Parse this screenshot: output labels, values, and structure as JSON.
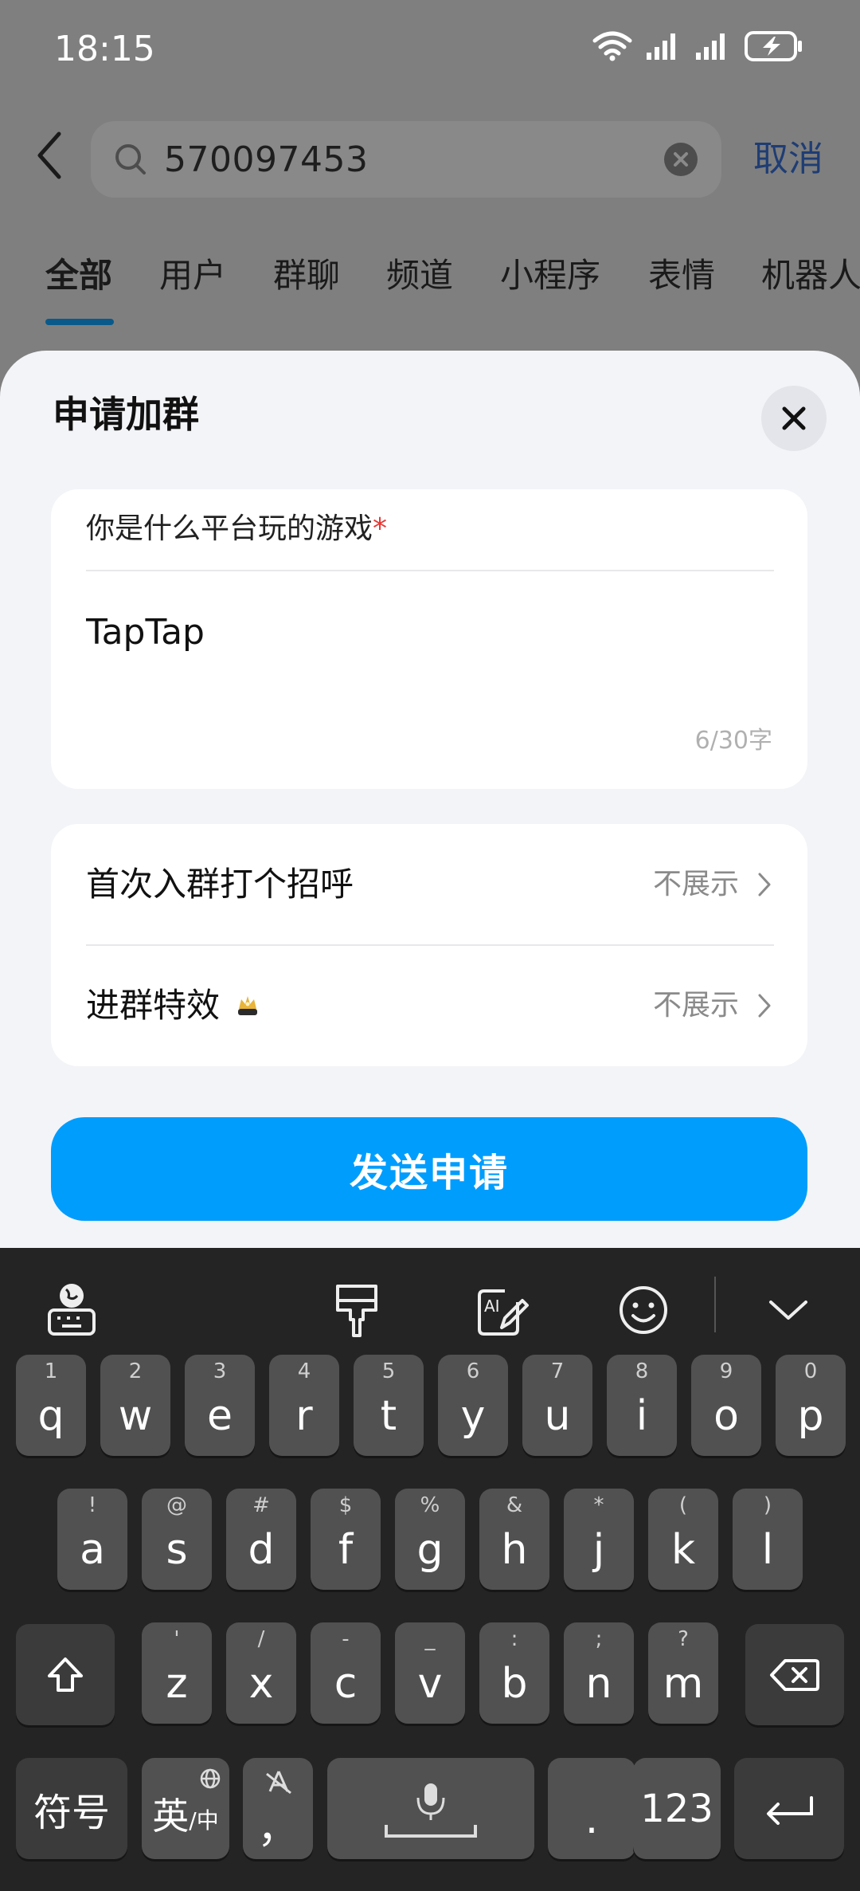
{
  "status": {
    "time": "18:15"
  },
  "search": {
    "query": "570097453",
    "cancel_label": "取消"
  },
  "tabs": [
    "全部",
    "用户",
    "群聊",
    "频道",
    "小程序",
    "表情",
    "机器人"
  ],
  "sheet": {
    "title": "申请加群",
    "question": {
      "label": "你是什么平台玩的游戏",
      "required_mark": "*",
      "answer": "TapTap",
      "counter": "6/30字"
    },
    "options": [
      {
        "label": "首次入群打个招呼",
        "value": "不展示"
      },
      {
        "label": "进群特效",
        "value": "不展示"
      }
    ],
    "send_label": "发送申请"
  },
  "keyboard": {
    "row1": [
      {
        "k": "q",
        "s": "1"
      },
      {
        "k": "w",
        "s": "2"
      },
      {
        "k": "e",
        "s": "3"
      },
      {
        "k": "r",
        "s": "4"
      },
      {
        "k": "t",
        "s": "5"
      },
      {
        "k": "y",
        "s": "6"
      },
      {
        "k": "u",
        "s": "7"
      },
      {
        "k": "i",
        "s": "8"
      },
      {
        "k": "o",
        "s": "9"
      },
      {
        "k": "p",
        "s": "0"
      }
    ],
    "row2": [
      {
        "k": "a",
        "s": "!"
      },
      {
        "k": "s",
        "s": "@"
      },
      {
        "k": "d",
        "s": "#"
      },
      {
        "k": "f",
        "s": "$"
      },
      {
        "k": "g",
        "s": "%"
      },
      {
        "k": "h",
        "s": "&"
      },
      {
        "k": "j",
        "s": "*"
      },
      {
        "k": "k",
        "s": "("
      },
      {
        "k": "l",
        "s": ")"
      }
    ],
    "row3": [
      {
        "k": "z",
        "s": "'"
      },
      {
        "k": "x",
        "s": "/"
      },
      {
        "k": "c",
        "s": "-"
      },
      {
        "k": "v",
        "s": "_"
      },
      {
        "k": "b",
        "s": ":"
      },
      {
        "k": "n",
        "s": ";"
      },
      {
        "k": "m",
        "s": "?"
      }
    ],
    "symbols_label": "符号",
    "lang_label": "英",
    "lang_sub": "/中",
    "comma_label": "，",
    "period_label": ".",
    "numbers_label": "123"
  },
  "colors": {
    "accent": "#009dfd",
    "cancel": "#1f3d74",
    "required": "#e53935"
  }
}
